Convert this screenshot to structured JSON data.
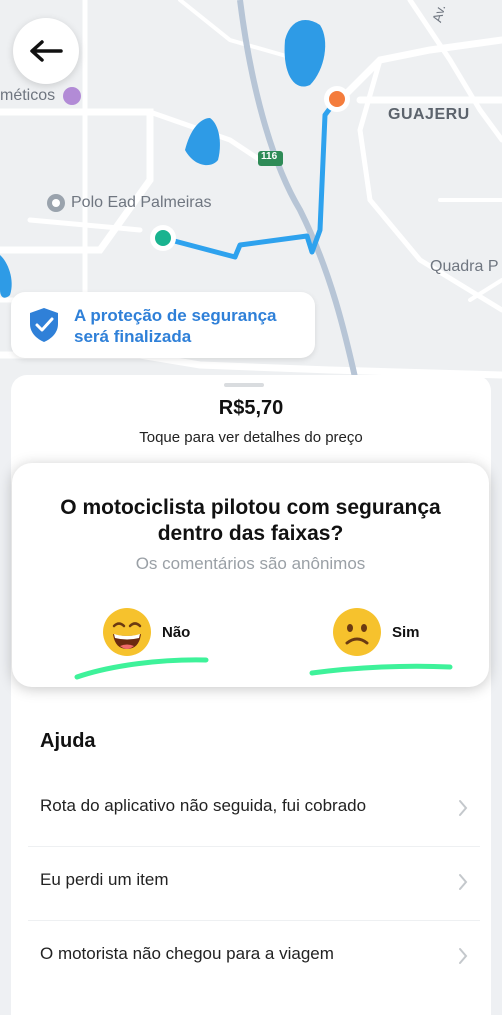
{
  "map": {
    "labels": {
      "cosmeticos": "méticos",
      "guajeru": "GUAJERU",
      "polo": "Polo Ead Palmeiras",
      "quadra": "Quadra P",
      "highway": "116",
      "av": "Av."
    }
  },
  "back_button": {
    "icon": "arrow-left-icon"
  },
  "safety": {
    "line1": "A proteção de segurança",
    "line2": "será finalizada",
    "color": "#2f80d8"
  },
  "trip": {
    "price": "R$5,70",
    "price_hint": "Toque para ver detalhes do preço"
  },
  "rating": {
    "question_line1": "O motociclista pilotou com segurança",
    "question_line2": "dentro das faixas?",
    "note": "Os comentários são anônimos",
    "option_left": "Não",
    "option_right": "Sim",
    "highlight_color": "#3ef29a"
  },
  "help": {
    "title": "Ajuda",
    "items": [
      "Rota do aplicativo não seguida, fui cobrado",
      "Eu perdi um item",
      "O motorista não chegou para a viagem"
    ]
  },
  "colors": {
    "route": "#2ea2ee",
    "pickup": "#19b38f",
    "dropoff": "#f47c3c"
  }
}
